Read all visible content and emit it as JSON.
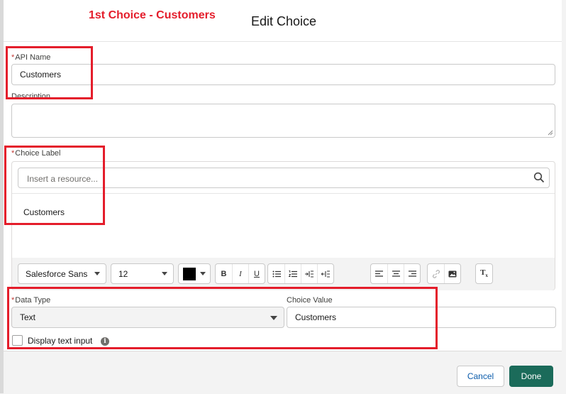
{
  "annotation": "1st Choice - Customers",
  "modal": {
    "title": "Edit Choice"
  },
  "api_name": {
    "label": "API Name",
    "required_mark": "*",
    "value": "Customers"
  },
  "description": {
    "label": "Description"
  },
  "choice_label": {
    "label": "Choice Label",
    "required_mark": "*",
    "resource_placeholder": "Insert a resource...",
    "content": "Customers",
    "toolbar": {
      "font_family": "Salesforce Sans",
      "font_size": "12",
      "text_color": "#000000",
      "buttons": [
        "bold",
        "italic",
        "underline",
        "bulleted-list",
        "numbered-list",
        "indent",
        "outdent",
        "align-left",
        "align-center",
        "align-right",
        "link",
        "image",
        "clear-formatting"
      ]
    }
  },
  "data_type": {
    "label": "Data Type",
    "required_mark": "*",
    "value": "Text"
  },
  "choice_value": {
    "label": "Choice Value",
    "value": "Customers"
  },
  "display_text_input": {
    "label": "Display text input",
    "checked": false
  },
  "footer": {
    "cancel": "Cancel",
    "done": "Done"
  },
  "colors": {
    "highlight": "#e41d2b",
    "done_button": "#1b6b5a",
    "required": "#c23934"
  }
}
